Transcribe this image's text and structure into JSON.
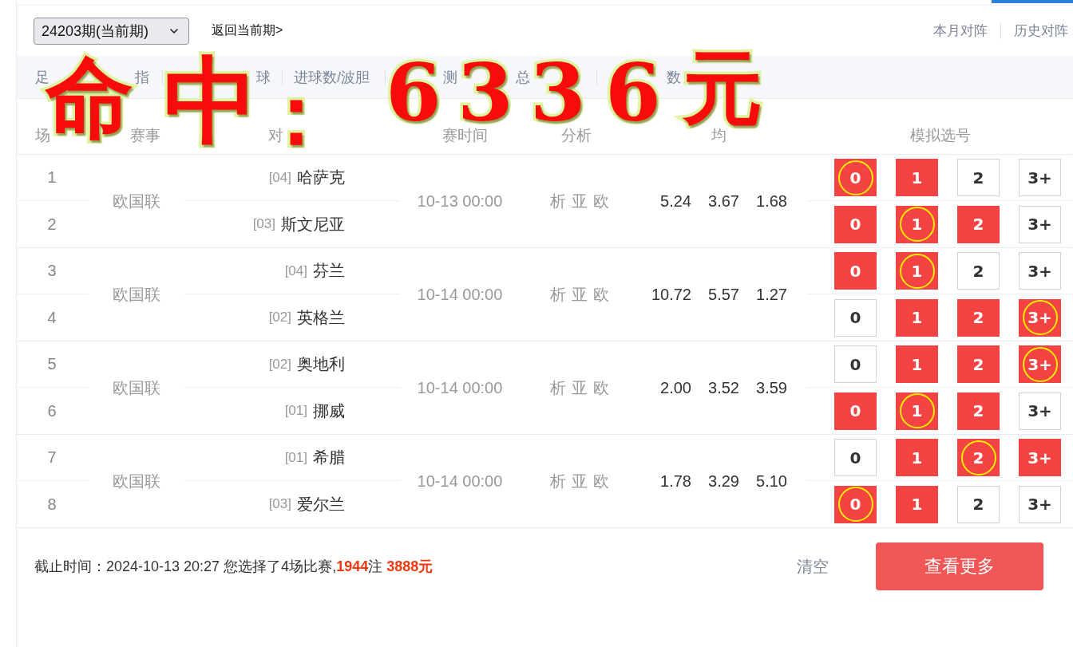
{
  "top_bar": {
    "issue_select": {
      "value": "24203期(当前期)"
    },
    "back_link": "返回当前期>",
    "right_links": [
      "本月对阵",
      "历史对阵"
    ]
  },
  "nav": {
    "segments": [
      {
        "items": [
          "足",
          "指"
        ]
      },
      {
        "items": [
          "球"
        ]
      },
      {
        "items": [
          "进球数/波胆"
        ]
      },
      {
        "items": [
          "测",
          "总"
        ]
      },
      {
        "items": [
          "数"
        ]
      }
    ]
  },
  "overlay": {
    "parts": [
      "命中：",
      "6336元"
    ]
  },
  "table": {
    "columns": [
      "场",
      "赛事",
      "对",
      "赛时间",
      "分析",
      "均",
      "模拟选号"
    ],
    "groups": [
      {
        "league": "欧国联",
        "kickoff": "10-13 00:00",
        "analysis": [
          "析",
          "亚",
          "欧"
        ],
        "odds": [
          "5.24",
          "3.67",
          "1.68"
        ],
        "matches": [
          {
            "no": "1",
            "rank": "[04]",
            "team": "哈萨克",
            "picks": [
              {
                "label": "0",
                "selected": true,
                "circled": true
              },
              {
                "label": "1",
                "selected": true,
                "circled": false
              },
              {
                "label": "2",
                "selected": false,
                "circled": false
              },
              {
                "label": "3+",
                "selected": false,
                "circled": false
              }
            ]
          },
          {
            "no": "2",
            "rank": "[03]",
            "team": "斯文尼亚",
            "picks": [
              {
                "label": "0",
                "selected": true,
                "circled": false
              },
              {
                "label": "1",
                "selected": true,
                "circled": true
              },
              {
                "label": "2",
                "selected": true,
                "circled": false
              },
              {
                "label": "3+",
                "selected": false,
                "circled": false
              }
            ]
          }
        ]
      },
      {
        "league": "欧国联",
        "kickoff": "10-14 00:00",
        "analysis": [
          "析",
          "亚",
          "欧"
        ],
        "odds": [
          "10.72",
          "5.57",
          "1.27"
        ],
        "matches": [
          {
            "no": "3",
            "rank": "[04]",
            "team": "芬兰",
            "picks": [
              {
                "label": "0",
                "selected": true,
                "circled": false
              },
              {
                "label": "1",
                "selected": true,
                "circled": true
              },
              {
                "label": "2",
                "selected": false,
                "circled": false
              },
              {
                "label": "3+",
                "selected": false,
                "circled": false
              }
            ]
          },
          {
            "no": "4",
            "rank": "[02]",
            "team": "英格兰",
            "picks": [
              {
                "label": "0",
                "selected": false,
                "circled": false
              },
              {
                "label": "1",
                "selected": true,
                "circled": false
              },
              {
                "label": "2",
                "selected": true,
                "circled": false
              },
              {
                "label": "3+",
                "selected": true,
                "circled": true
              }
            ]
          }
        ]
      },
      {
        "league": "欧国联",
        "kickoff": "10-14 00:00",
        "analysis": [
          "析",
          "亚",
          "欧"
        ],
        "odds": [
          "2.00",
          "3.52",
          "3.59"
        ],
        "matches": [
          {
            "no": "5",
            "rank": "[02]",
            "team": "奥地利",
            "picks": [
              {
                "label": "0",
                "selected": false,
                "circled": false
              },
              {
                "label": "1",
                "selected": true,
                "circled": false
              },
              {
                "label": "2",
                "selected": true,
                "circled": false
              },
              {
                "label": "3+",
                "selected": true,
                "circled": true
              }
            ]
          },
          {
            "no": "6",
            "rank": "[01]",
            "team": "挪威",
            "picks": [
              {
                "label": "0",
                "selected": true,
                "circled": false
              },
              {
                "label": "1",
                "selected": true,
                "circled": true
              },
              {
                "label": "2",
                "selected": true,
                "circled": false
              },
              {
                "label": "3+",
                "selected": false,
                "circled": false
              }
            ]
          }
        ]
      },
      {
        "league": "欧国联",
        "kickoff": "10-14 00:00",
        "analysis": [
          "析",
          "亚",
          "欧"
        ],
        "odds": [
          "1.78",
          "3.29",
          "5.10"
        ],
        "matches": [
          {
            "no": "7",
            "rank": "[01]",
            "team": "希腊",
            "picks": [
              {
                "label": "0",
                "selected": false,
                "circled": false
              },
              {
                "label": "1",
                "selected": true,
                "circled": false
              },
              {
                "label": "2",
                "selected": true,
                "circled": true
              },
              {
                "label": "3+",
                "selected": true,
                "circled": false
              }
            ]
          },
          {
            "no": "8",
            "rank": "[03]",
            "team": "爱尔兰",
            "picks": [
              {
                "label": "0",
                "selected": true,
                "circled": true
              },
              {
                "label": "1",
                "selected": true,
                "circled": false
              },
              {
                "label": "2",
                "selected": false,
                "circled": false
              },
              {
                "label": "3+",
                "selected": false,
                "circled": false
              }
            ]
          }
        ]
      }
    ]
  },
  "footer": {
    "summary": "截止时间：2024-10-13 20:27 您选择了4场比赛,**1944**注 **3888元**",
    "clear_link": "清空",
    "more_button": "查看更多"
  }
}
